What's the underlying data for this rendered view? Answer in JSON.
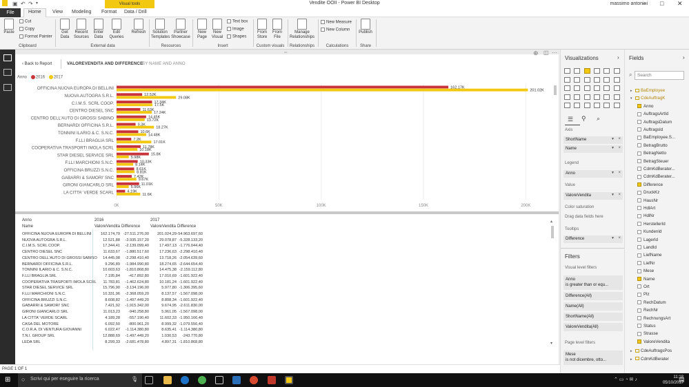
{
  "window": {
    "title": "Vendite OOII - Power BI Desktop",
    "contextual_tab": "Visual tools",
    "user": "massimo antonini"
  },
  "tabs": [
    "File",
    "Home",
    "View",
    "Modeling",
    "Format",
    "Data / Drill"
  ],
  "ribbon": {
    "clipboard": {
      "paste": "Paste",
      "cut": "Cut",
      "copy": "Copy",
      "format_painter": "Format Painter",
      "group": "Clipboard"
    },
    "external": {
      "get_data": "Get Data",
      "recent_sources": "Recent Sources",
      "enter_data": "Enter Data",
      "edit_queries": "Edit Queries",
      "refresh": "Refresh",
      "group": "External data"
    },
    "resources": {
      "solution_templates": "Solution Templates",
      "partner_showcase": "Partner Showcase",
      "group": "Resources"
    },
    "insert": {
      "new_page": "New Page",
      "new_visual": "New Visual",
      "text_box": "Text box",
      "image": "Image",
      "shapes": "Shapes",
      "group": "Insert"
    },
    "custom_visuals": {
      "from_store": "From Store",
      "from_file": "From File",
      "group": "Custom visuals"
    },
    "relationships": {
      "manage": "Manage Relationships",
      "group": "Relationships"
    },
    "calculations": {
      "new_measure": "New Measure",
      "new_column": "New Column",
      "group": "Calculations"
    },
    "share": {
      "publish": "Publish",
      "group": "Share"
    }
  },
  "report": {
    "back": "Back to Report",
    "header_active": "VALOREVENDITA AND DIFFERENCE",
    "header_secondary": "BY NAME AND ANNO",
    "legend_title": "Anno",
    "status": "PAGE 1 OF 1"
  },
  "colors": {
    "s2016": "#c9343a",
    "s2017": "#f2c811",
    "accent": "#f2c811"
  },
  "chart_data": {
    "type": "bar",
    "orientation": "horizontal",
    "categories": [
      "OFFICINA NUOVA EUROPA DI BELLINI",
      "NUOVA AUTOGRA S.R.L.",
      "C.I.M.S. SCRL COOP.",
      "CENTRO DIESEL SNC",
      "CENTRO DELL'AUTO DI GROSSI SABINO",
      "BERNARDI OFFICINA S.R.L.",
      "TONNINI ILARIO & C. S.N.C.",
      "F.LLI BRAGLIA SRL",
      "COOPERATIVA TRASPORTI IMOLA SCRL",
      "STAR DIESEL SERVICE SRL",
      "F.LLI MARCHIONI S.N.C.",
      "OFFICINA BRUZZI S.N.C.",
      "GABARRI & SAMORI' SNC",
      "GIRONI GIANCARLO SRL",
      "LA CITTA' VERDE SCARL"
    ],
    "series": [
      {
        "name": "2016",
        "values": [
          162174.79,
          12521.88,
          17344.41,
          11633.67,
          14445.08,
          9296.89,
          10603.63,
          7195.84,
          11783.81,
          15796.9,
          10331.96,
          8608.82,
          7421.92,
          11013.23,
          4189.28
        ],
        "labels": [
          "162.17K",
          "12.52K",
          "17.34K",
          "11.63K",
          "14.45K",
          "9.3K",
          "10.6K",
          "7.2K",
          "11.78K",
          "15.8K",
          "10.33K",
          "8.61K",
          "7.42K",
          "11.01K",
          "4.19K"
        ]
      },
      {
        "name": "2017",
        "values": [
          201024.29,
          29078.87,
          17497.13,
          17236.63,
          13718.26,
          18274.65,
          14475.38,
          17010.69,
          10181.24,
          5977.8,
          8137.57,
          8808.34,
          9674.95,
          5961.05,
          11602.33
        ],
        "labels": [
          "201.02K",
          "29.08K",
          "17.5K",
          "17.24K",
          "13.72K",
          "18.27K",
          "14.48K",
          "17.01K",
          "10.18K",
          "5.98K",
          "8.14K",
          "8.81K",
          "9.67K",
          "5.96K",
          "11.6K"
        ]
      }
    ],
    "xticks": [
      "0K",
      "50K",
      "100K",
      "150K",
      "200K"
    ],
    "xlim": [
      0,
      210000
    ],
    "legend_placement": "top-left"
  },
  "matrix": {
    "header_anno": "Anno",
    "header_name": "Name",
    "y2016": "2016",
    "y2017": "2017",
    "col_vv": "ValoreVendita",
    "col_diff": "Difference",
    "rows": [
      [
        "OFFICINA NUOVA EUROPA DI BELLINI",
        "162.174,79",
        "-27.511.276,00",
        "201.024,29",
        "-54.963.697,60"
      ],
      [
        "NUOVA AUTOGRA S.R.L.",
        "12.521,88",
        "-3.935.157,20",
        "29.078,87",
        "-5.328.133,20"
      ],
      [
        "C.I.M.S. SCRL COOP.",
        "17.344,41",
        "-2.139.099,40",
        "17.497,13",
        "-1.776.044,40"
      ],
      [
        "CENTRO DIESEL SNC",
        "11.633,67",
        "-1.880.517,60",
        "17.236,63",
        "-2.298.410,40"
      ],
      [
        "CENTRO DELL'AUTO DI GROSSI SABINO",
        "14.445,08",
        "-2.298.410,40",
        "13.718,26",
        "-2.054.639,60"
      ],
      [
        "BERNARDI OFFICINA S.R.L.",
        "9.296,89",
        "-1.984.990,80",
        "18.274,65",
        "-2.644.654,40"
      ],
      [
        "TONNINI ILARIO & C. S.N.C.",
        "10.603,63",
        "-1.810.868,80",
        "14.475,38",
        "-2.159.112,80"
      ],
      [
        "F.LLI BRAGLIA SRL",
        "7.195,84",
        "-417.892,80",
        "17.010,69",
        "-1.601.922,40"
      ],
      [
        "COOPERATIVA TRASPORTI IMOLA SCRL",
        "11.783,81",
        "-1.462.624,80",
        "10.181,24",
        "-1.601.922,40"
      ],
      [
        "STAR DIESEL SERVICE SRL",
        "15.796,90",
        "-3.134.196,00",
        "5.977,80",
        "-1.306.395,60"
      ],
      [
        "F.LLI MARCHIONI S.N.C.",
        "10.331,96",
        "-2.368.059,20",
        "8.137,57",
        "-1.567.098,00"
      ],
      [
        "OFFICINA BRUZZI S.N.C.",
        "8.608,82",
        "-1.497.449,20",
        "8.808,34",
        "-1.601.922,40"
      ],
      [
        "GABARRI & SAMORI' SNC",
        "7.421,92",
        "-1.915.342,00",
        "9.674,95",
        "-2.611.830,00"
      ],
      [
        "GIRONI GIANCARLO SRL",
        "11.013,23",
        "-940.258,80",
        "5.961,05",
        "-1.567.098,00"
      ],
      [
        "LA CITTA' VERDE SCARL",
        "4.189,28",
        "-557.190,40",
        "11.602,33",
        "-1.950.166,40"
      ],
      [
        "CASA DEL MOTORE",
        "6.092,50",
        "-800.961,20",
        "8.999,32",
        "-1.079.556,40"
      ],
      [
        "C.O.R.A. DI VENTURA GIOVANNI",
        "6.022,47",
        "-1.114.380,80",
        "8.635,41",
        "-1.114.380,80"
      ],
      [
        "T.N.I. GROUP SRL",
        "12.888,69",
        "-1.497.449,20",
        "1.030,53",
        "-243.770,80"
      ],
      [
        "LEDA SRL",
        "8.299,33",
        "-2.681.478,80",
        "4.897,31",
        "-1.810.868,80"
      ]
    ]
  },
  "visualizations": {
    "title": "Visualizations",
    "axis_label": "Axis",
    "axis_fields": [
      "ShortName",
      "Name"
    ],
    "legend_label": "Legend",
    "legend_field": "Anno",
    "value_label": "Value",
    "value_field": "ValoreVendita",
    "saturation_label": "Color saturation",
    "saturation_placeholder": "Drag data fields here",
    "tooltips_label": "Tooltips",
    "tooltips_field": "Difference",
    "filters_title": "Filters",
    "visual_filters_label": "Visual level filters",
    "filters": [
      {
        "name": "Anno",
        "cond": "is greater than or equ..."
      },
      {
        "name": "Difference(All)"
      },
      {
        "name": "Name(All)"
      },
      {
        "name": "ShortName(All)"
      },
      {
        "name": "ValoreVendita(All)"
      }
    ],
    "page_filters_label": "Page level filters",
    "page_filter": {
      "name": "Mese",
      "cond": "is not dicembre, otto..."
    }
  },
  "fields": {
    "title": "Fields",
    "search_placeholder": "Search",
    "tables": [
      {
        "name": "BaEmployee"
      },
      {
        "name": "CdeAuftragK"
      }
    ],
    "items": [
      {
        "name": "Anno",
        "checked": true
      },
      {
        "name": "AuftragsArtId",
        "checked": false
      },
      {
        "name": "AuftragsDatum",
        "checked": false
      },
      {
        "name": "AuftragsId",
        "checked": false
      },
      {
        "name": "BaEmployee.S...",
        "checked": false
      },
      {
        "name": "BetragBrutto",
        "checked": false
      },
      {
        "name": "BetragNetto",
        "checked": false
      },
      {
        "name": "BetragSteuer",
        "checked": false
      },
      {
        "name": "CdmKdBerater...",
        "checked": false
      },
      {
        "name": "CdmKdBerater...",
        "checked": false
      },
      {
        "name": "Difference",
        "checked": true
      },
      {
        "name": "DruckKz",
        "checked": false
      },
      {
        "name": "HausNr",
        "checked": false
      },
      {
        "name": "HdlArt",
        "checked": false
      },
      {
        "name": "HdlNr",
        "checked": false
      },
      {
        "name": "HerstellerId",
        "checked": false
      },
      {
        "name": "KundenId",
        "checked": false
      },
      {
        "name": "LagerId",
        "checked": false
      },
      {
        "name": "LandId",
        "checked": false
      },
      {
        "name": "LiefName",
        "checked": false
      },
      {
        "name": "LiefNr",
        "checked": false
      },
      {
        "name": "Mese",
        "checked": false
      },
      {
        "name": "Name",
        "checked": true
      },
      {
        "name": "Ort",
        "checked": false
      },
      {
        "name": "Plz",
        "checked": false
      },
      {
        "name": "RechDatum",
        "checked": false
      },
      {
        "name": "RechNr",
        "checked": false
      },
      {
        "name": "RechnungsArt",
        "checked": false
      },
      {
        "name": "Status",
        "checked": false
      },
      {
        "name": "Strasse",
        "checked": false
      },
      {
        "name": "ValoreVendita",
        "checked": true
      }
    ],
    "tables_bottom": [
      {
        "name": "CdeAuftragsPos"
      },
      {
        "name": "CdmKdBerater"
      }
    ]
  },
  "taskbar": {
    "search": "Scrivi qui per eseguire la ricerca",
    "time": "11:18",
    "date": "05/10/2017"
  }
}
